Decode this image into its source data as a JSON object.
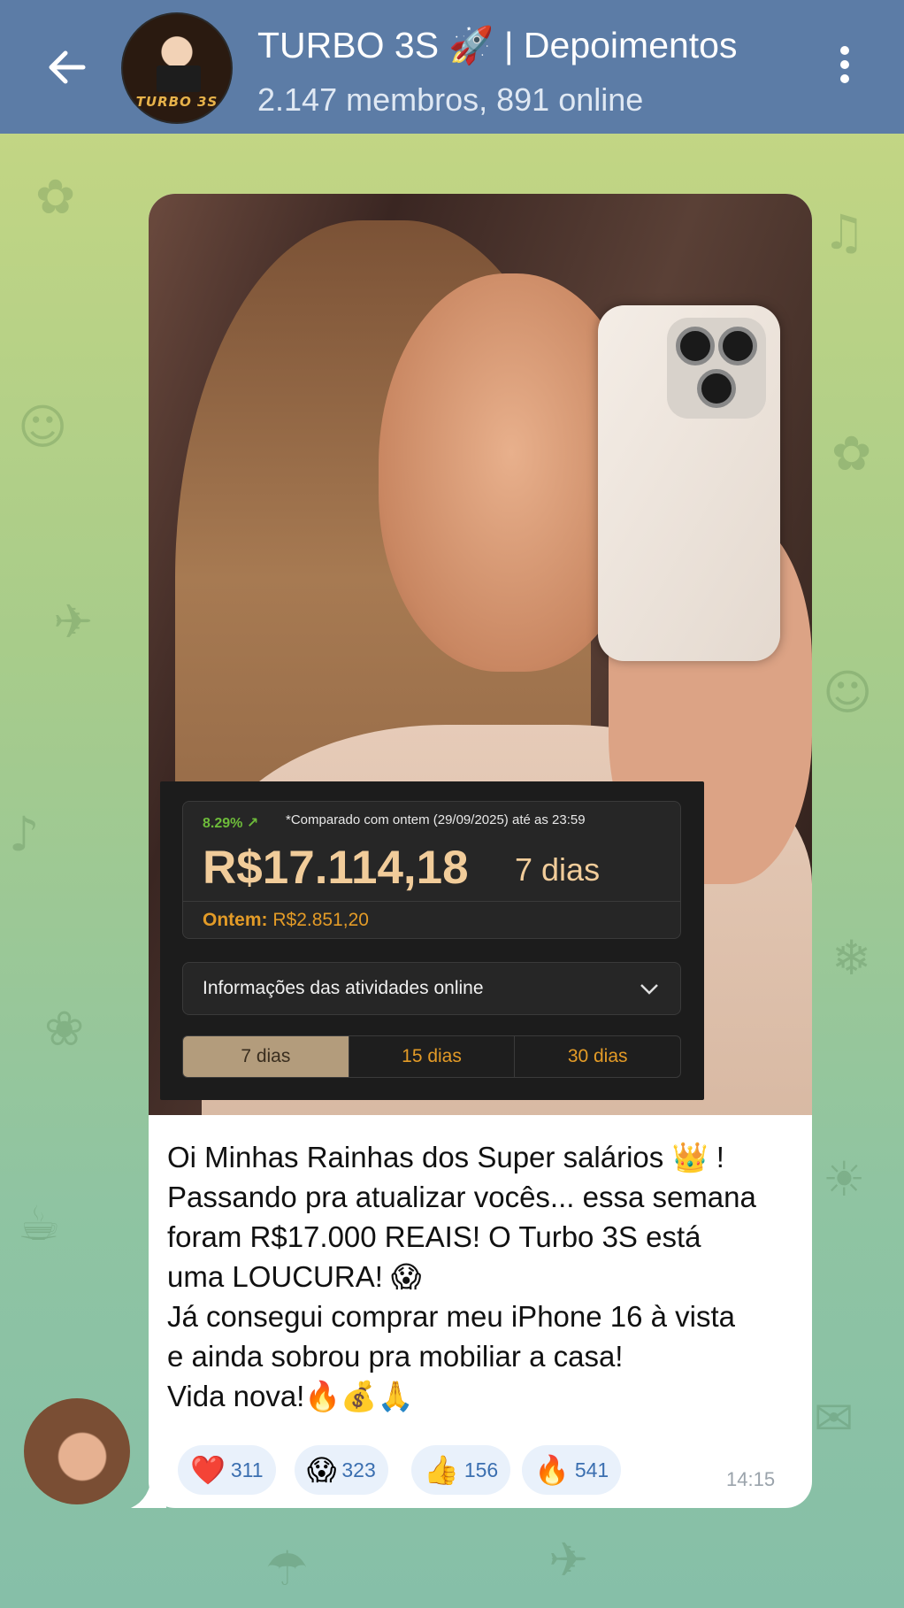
{
  "header": {
    "title": "TURBO 3S 🚀 | Depoimentos",
    "subtitle": "2.147 membros, 891 online",
    "avatar_logo_text": "TURBO 3S",
    "back_icon": "arrow-left-icon",
    "menu_icon": "more-vertical-icon",
    "bar_color": "#5c7ca6"
  },
  "earnings_card": {
    "growth_percent": "8.29%",
    "growth_icon": "trend-up-icon",
    "compare_note": "*Comparado com ontem (29/09/2025) até as 23:59",
    "amount": "R$17.114,18",
    "period": "7 dias",
    "yesterday_label": "Ontem:",
    "yesterday_value": "R$2.851,20",
    "activity_dropdown": "Informações das atividades online",
    "tabs": [
      {
        "label": "7 dias",
        "active": true
      },
      {
        "label": "15 dias",
        "active": false
      },
      {
        "label": "30 dias",
        "active": false
      }
    ]
  },
  "message": {
    "lines": [
      "Oi Minhas Rainhas dos Super salários 👑 !",
      "Passando pra atualizar vocês... essa semana",
      "foram R$17.000 REAIS! O Turbo 3S está",
      "uma LOUCURA! 😱",
      "Já consegui comprar meu iPhone 16 à vista",
      "e ainda sobrou pra mobiliar a casa!",
      "Vida nova!🔥💰🙏"
    ],
    "time": "14:15",
    "reactions": [
      {
        "emoji": "❤️",
        "icon": "heart-icon",
        "count": "311"
      },
      {
        "emoji": "😱",
        "icon": "scream-face-icon",
        "count": "323"
      },
      {
        "emoji": "👍",
        "icon": "thumbs-up-icon",
        "count": "156"
      },
      {
        "emoji": "🔥",
        "icon": "fire-icon",
        "count": "541"
      }
    ]
  }
}
